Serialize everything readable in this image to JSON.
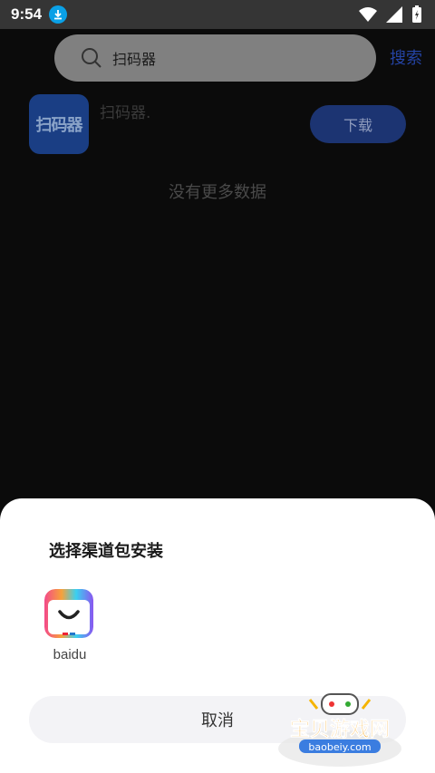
{
  "status": {
    "time": "9:54"
  },
  "search": {
    "query": "扫码器",
    "button": "搜索"
  },
  "result": {
    "app_icon_text": "扫码器",
    "name": "扫码器.",
    "download": "下载"
  },
  "empty_note": "没有更多数据",
  "sheet": {
    "title": "选择渠道包安装",
    "channels": [
      {
        "label": "baidu"
      }
    ],
    "cancel": "取消"
  },
  "watermark": {
    "title": "宝贝游戏网",
    "url": "baobeiy.com"
  }
}
